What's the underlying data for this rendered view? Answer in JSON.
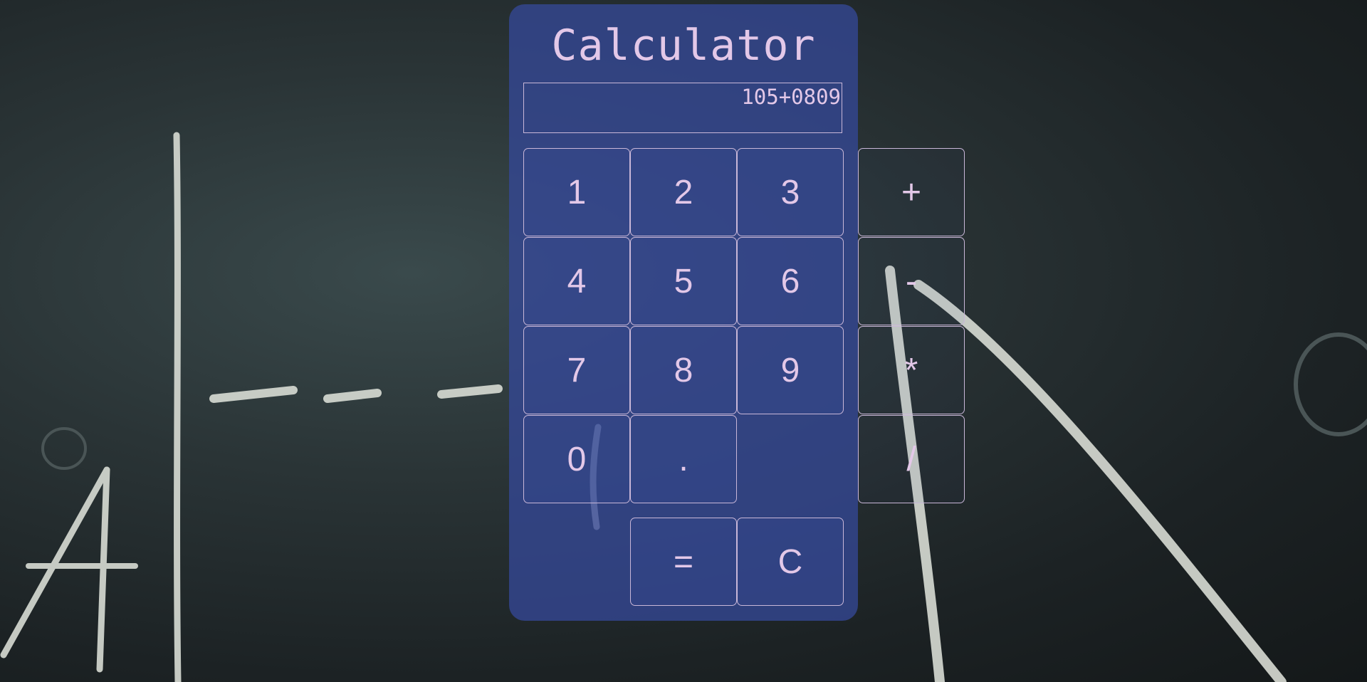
{
  "calculator": {
    "title": "Calculator",
    "display": "105+0809"
  },
  "keys": {
    "k1": "1",
    "k2": "2",
    "k3": "3",
    "k4": "4",
    "k5": "5",
    "k6": "6",
    "k7": "7",
    "k8": "8",
    "k9": "9",
    "k0": "0",
    "dot": ".",
    "equals": "=",
    "clear": "C"
  },
  "operators": {
    "plus": "+",
    "minus": "-",
    "multiply": "*",
    "divide": "/"
  },
  "colors": {
    "panel": "#344896",
    "text": "#e3c8e8",
    "border": "#c9b7d8"
  }
}
